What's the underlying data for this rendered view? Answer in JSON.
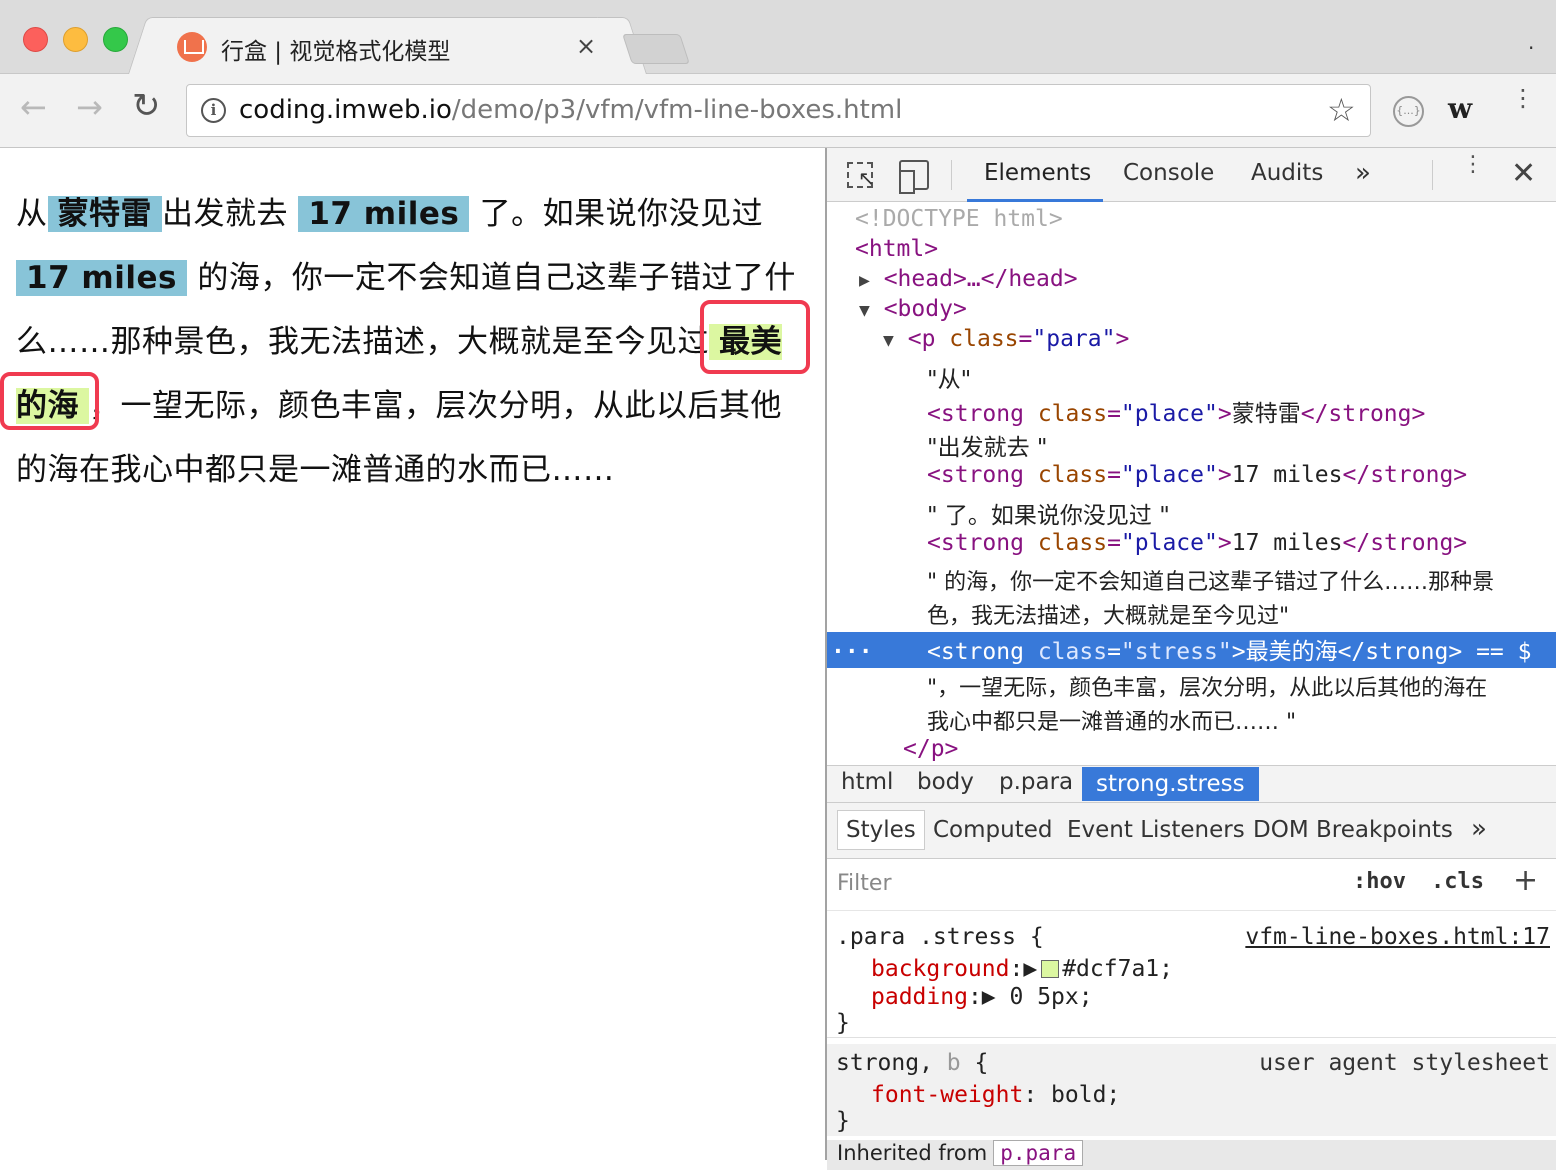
{
  "window": {
    "tab_title": "行盒 | 视觉格式化模型",
    "tab_close": "×",
    "title_dot": "."
  },
  "toolbar": {
    "back": "←",
    "forward": "→",
    "reload": "↻",
    "url_host": "coding.imweb.io",
    "url_path": "/demo/p3/vfm/vfm-line-boxes.html",
    "info_icon": "i",
    "star_icon": "☆",
    "ext_icon": "{...}",
    "w_icon": "w",
    "menu_icon": "⋮"
  },
  "page": {
    "segments": [
      {
        "type": "text",
        "text": "从"
      },
      {
        "type": "place",
        "text": "蒙特雷"
      },
      {
        "type": "text",
        "text": "出发就去 "
      },
      {
        "type": "place",
        "text": "17 miles"
      },
      {
        "type": "text",
        "text": " 了。如果说你没见过 "
      },
      {
        "type": "place",
        "text": "17 miles"
      },
      {
        "type": "text",
        "text": " 的海，你一定不会知道自己这辈子错过了什么……那种景色，我无法描述，大概就是至今见过"
      },
      {
        "type": "stress",
        "text": "最美的海"
      },
      {
        "type": "text",
        "text": "，一望无际，颜色丰富，层次分明，从此以后其他的海在我心中都只是一滩普通的水而已……"
      }
    ]
  },
  "devtools": {
    "tabs": [
      "Elements",
      "Console",
      "Audits"
    ],
    "more": "»",
    "kebab": "⋮",
    "close": "✕",
    "dom": {
      "doctype": "<!DOCTYPE html>",
      "html_open": "<html>",
      "head": "<head>…</head>",
      "body_open": "<body>",
      "p_open_tag": "p",
      "p_attr": "class",
      "p_val": "\"para\"",
      "text_1": "\"从\"",
      "strong_tag": "strong",
      "attr_class": "class",
      "val_place": "\"place\"",
      "val_stress": "\"stress\"",
      "strong_1_text": "蒙特雷",
      "text_2": "\"出发就去 \"",
      "strong_2_text": "17 miles",
      "text_3": "\" 了。如果说你没见过 \"",
      "strong_3_text": "17 miles",
      "text_4a": "\" 的海，你一定不会知道自己这辈子错过了什么……那种景",
      "text_4b": "色，我无法描述，大概就是至今见过\"",
      "selected_text": "最美的海",
      "selected_suffix": " == $",
      "selected_dots": "···",
      "text_5a": "\"，一望无际，颜色丰富，层次分明，从此以后其他的海在",
      "text_5b": "我心中都只是一滩普通的水而已…… \"",
      "p_close": "</p>"
    },
    "breadcrumbs": [
      "html",
      "body",
      "p.para",
      "strong.stress"
    ],
    "styles_tabs": [
      "Styles",
      "Computed",
      "Event Listeners",
      "DOM Breakpoints"
    ],
    "styles_more": "»",
    "filter_placeholder": "Filter",
    "hov": ":hov",
    "cls": ".cls",
    "plus": "+",
    "rule1": {
      "selector": ".para .stress {",
      "source": "vfm-line-boxes.html:17",
      "props": [
        {
          "name": "background",
          "value": "#dcf7a1;",
          "swatch": "#dcf7a1"
        },
        {
          "name": "padding",
          "value": "0 5px;"
        }
      ],
      "close": "}"
    },
    "rule2": {
      "selector_a": "strong, ",
      "selector_b": "b",
      "selector_c": " {",
      "source": "user agent stylesheet",
      "props": [
        {
          "name": "font-weight",
          "value": "bold;"
        }
      ],
      "close": "}"
    },
    "inherited_label": "Inherited from",
    "inherited_selector": "p.para"
  }
}
